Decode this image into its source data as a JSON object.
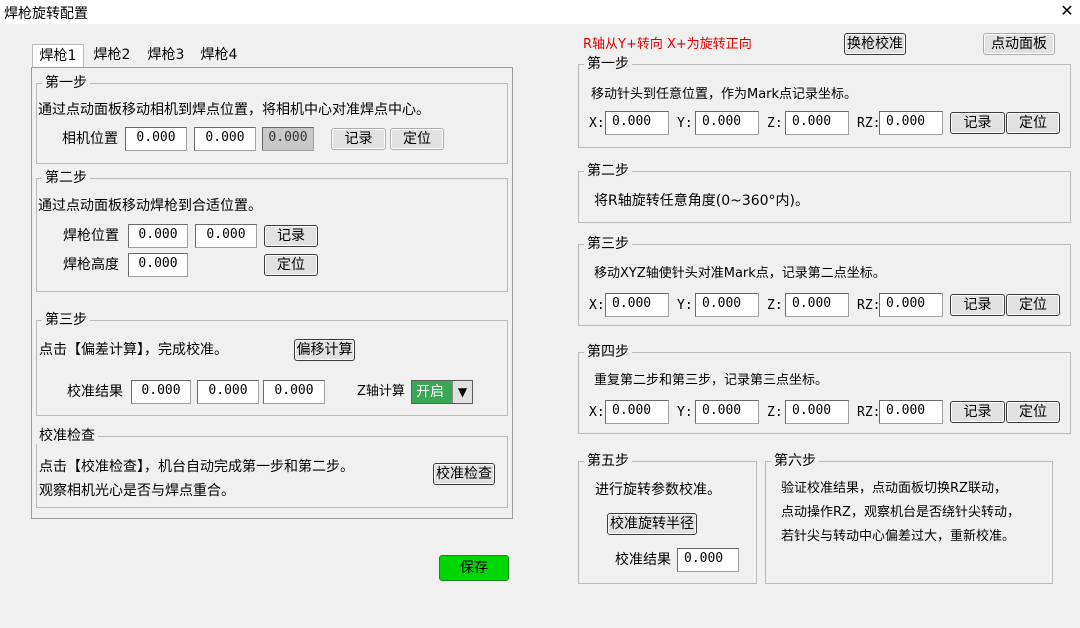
{
  "window": {
    "title": "焊枪旋转配置",
    "close_icon": "✕"
  },
  "left": {
    "tabs": [
      "焊枪1",
      "焊枪2",
      "焊枪3",
      "焊枪4"
    ],
    "step1": {
      "legend": "第一步",
      "desc": "通过点动面板移动相机到焊点位置，将相机中心对准焊点中心。",
      "field_label": "相机位置",
      "values": [
        "0.000",
        "0.000",
        "0.000"
      ],
      "record": "记录",
      "locate": "定位"
    },
    "step2": {
      "legend": "第二步",
      "desc": "通过点动面板移动焊枪到合适位置。",
      "pos_label": "焊枪位置",
      "pos_values": [
        "0.000",
        "0.000"
      ],
      "height_label": "焊枪高度",
      "height_value": "0.000",
      "record": "记录",
      "locate": "定位"
    },
    "step3": {
      "legend": "第三步",
      "desc": "点击【偏差计算】，完成校准。",
      "calc_button": "偏移计算",
      "result_label": "校准结果",
      "result_values": [
        "0.000",
        "0.000",
        "0.000"
      ],
      "z_label": "Z轴计算",
      "z_value": "开启",
      "z_arrow": "▼"
    },
    "check": {
      "legend": "校准检查",
      "line1": "点击【校准检查】，机台自动完成第一步和第二步。",
      "line2": "观察相机光心是否与焊点重合。",
      "button": "校准检查"
    },
    "save": "保存"
  },
  "right": {
    "notice": "R轴从Y+转向 X+为旋转正向",
    "swap_button": "换枪校准",
    "jog_button": "点动面板",
    "step1": {
      "legend": "第一步",
      "desc": "移动针头到任意位置，作为Mark点记录坐标。",
      "x_label": "X:",
      "x": "0.000",
      "y_label": "Y:",
      "y": "0.000",
      "z_label": "Z:",
      "z": "0.000",
      "rz_label": "RZ:",
      "rz": "0.000",
      "record": "记录",
      "locate": "定位"
    },
    "step2": {
      "legend": "第二步",
      "desc": "将R轴旋转任意角度(0~360°内)。"
    },
    "step3": {
      "legend": "第三步",
      "desc": "移动XYZ轴使针头对准Mark点，记录第二点坐标。",
      "x_label": "X:",
      "x": "0.000",
      "y_label": "Y:",
      "y": "0.000",
      "z_label": "Z:",
      "z": "0.000",
      "rz_label": "RZ:",
      "rz": "0.000",
      "record": "记录",
      "locate": "定位"
    },
    "step4": {
      "legend": "第四步",
      "desc": "重复第二步和第三步，记录第三点坐标。",
      "x_label": "X:",
      "x": "0.000",
      "y_label": "Y:",
      "y": "0.000",
      "z_label": "Z:",
      "z": "0.000",
      "rz_label": "RZ:",
      "rz": "0.000",
      "record": "记录",
      "locate": "定位"
    },
    "step5": {
      "legend": "第五步",
      "desc": "进行旋转参数校准。",
      "button": "校准旋转半径",
      "result_label": "校准结果",
      "result_value": "0.000"
    },
    "step6": {
      "legend": "第六步",
      "line1": "验证校准结果，点动面板切换RZ联动，",
      "line2": "点动操作RZ，观察机台是否绕针尖转动，",
      "line3": "若针尖与转动中心偏差过大，重新校准。"
    }
  }
}
